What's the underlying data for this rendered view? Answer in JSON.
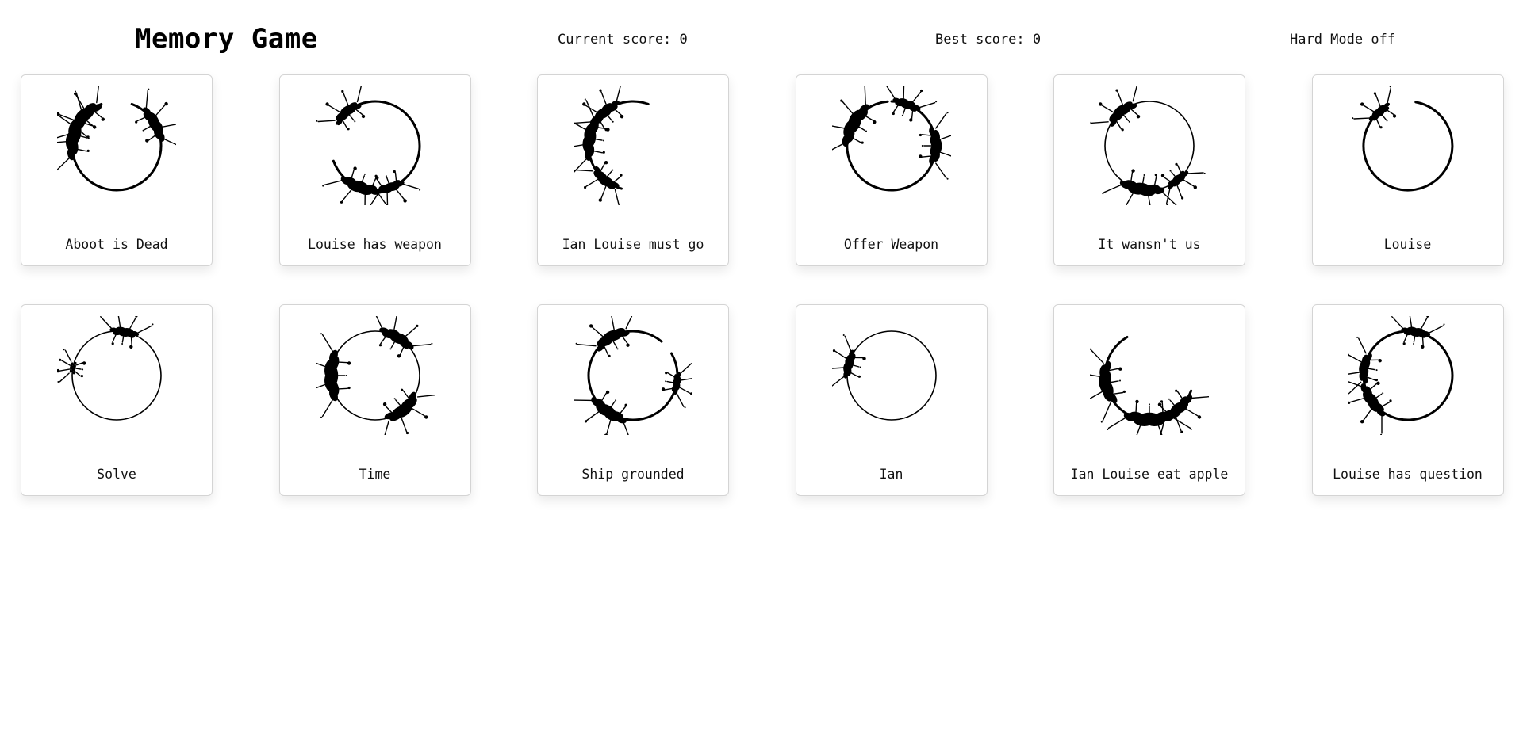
{
  "header": {
    "title": "Memory Game",
    "current_score": "Current score: 0",
    "best_score": "Best score: 0",
    "hard_mode": "Hard Mode off"
  },
  "cards": [
    {
      "label": "Aboot is Dead",
      "icon": "logogram-aboot-is-dead-icon",
      "arc": [
        20,
        340
      ],
      "blots": [
        [
          285,
          1.6
        ],
        [
          310,
          1.4
        ],
        [
          60,
          1.2
        ]
      ],
      "thin": false
    },
    {
      "label": "Louise has weapon",
      "icon": "logogram-louise-has-weapon-icon",
      "arc": [
        300,
        250
      ],
      "blots": [
        [
          200,
          1.3
        ],
        [
          320,
          1.0
        ],
        [
          160,
          0.9
        ]
      ],
      "thin": false
    },
    {
      "label": "Ian Louise must go",
      "icon": "logogram-ian-louise-must-go-icon",
      "arc": [
        195,
        20
      ],
      "blots": [
        [
          280,
          1.4
        ],
        [
          220,
          1.0
        ],
        [
          320,
          1.1
        ]
      ],
      "thin": false
    },
    {
      "label": "Offer Weapon",
      "icon": "logogram-offer-weapon-icon",
      "arc": [
        0,
        355
      ],
      "blots": [
        [
          300,
          1.5
        ],
        [
          90,
          1.2
        ],
        [
          20,
          0.9
        ]
      ],
      "thin": false
    },
    {
      "label": "It wansn't us",
      "icon": "logogram-it-wasnt-us-icon",
      "arc": [
        0,
        360
      ],
      "blots": [
        [
          190,
          1.4
        ],
        [
          320,
          1.1
        ],
        [
          140,
          0.8
        ]
      ],
      "thin": true
    },
    {
      "label": "Louise",
      "icon": "logogram-louise-icon",
      "arc": [
        10,
        330
      ],
      "blots": [
        [
          320,
          0.8
        ]
      ],
      "thin": false
    },
    {
      "label": "Solve",
      "icon": "logogram-solve-icon",
      "arc": [
        0,
        360
      ],
      "blots": [
        [
          10,
          0.9
        ],
        [
          280,
          0.4
        ]
      ],
      "thin": true
    },
    {
      "label": "Time",
      "icon": "logogram-time-icon",
      "arc": [
        0,
        360
      ],
      "blots": [
        [
          270,
          1.6
        ],
        [
          140,
          1.3
        ],
        [
          30,
          1.2
        ]
      ],
      "thin": true
    },
    {
      "label": "Ship grounded",
      "icon": "logogram-ship-grounded-icon",
      "arc": [
        60,
        40
      ],
      "blots": [
        [
          215,
          1.3
        ],
        [
          330,
          1.2
        ],
        [
          100,
          0.7
        ]
      ],
      "thin": false
    },
    {
      "label": "Ian",
      "icon": "logogram-ian-icon",
      "arc": [
        0,
        360
      ],
      "blots": [
        [
          285,
          0.9
        ]
      ],
      "thin": true
    },
    {
      "label": "Ian Louise eat apple",
      "icon": "logogram-ian-louise-eat-apple-icon",
      "arc": [
        110,
        330
      ],
      "blots": [
        [
          180,
          1.6
        ],
        [
          260,
          1.4
        ],
        [
          140,
          1.2
        ]
      ],
      "thin": false
    },
    {
      "label": "Louise has question",
      "icon": "logogram-louise-has-question-icon",
      "arc": [
        0,
        360
      ],
      "blots": [
        [
          235,
          1.2
        ],
        [
          280,
          1.0
        ],
        [
          10,
          0.9
        ]
      ],
      "thin": false
    }
  ],
  "colors": {
    "ink": "#000000",
    "card_border": "#d4d4d4",
    "background": "#ffffff"
  }
}
